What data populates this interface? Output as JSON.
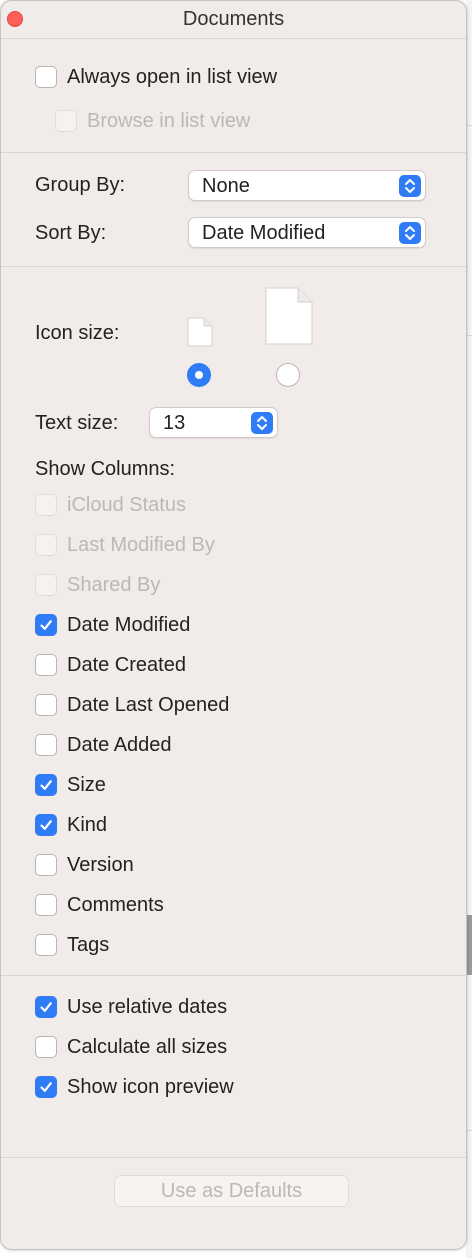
{
  "window": {
    "title": "Documents"
  },
  "top_options": [
    {
      "label": "Always open in list view",
      "checked": false,
      "disabled": false
    },
    {
      "label": "Browse in list view",
      "checked": false,
      "disabled": true
    }
  ],
  "group_by": {
    "label": "Group By:",
    "value": "None"
  },
  "sort_by": {
    "label": "Sort By:",
    "value": "Date Modified"
  },
  "icon_size": {
    "label": "Icon size:",
    "selected": "small"
  },
  "text_size": {
    "label": "Text size:",
    "value": "13"
  },
  "show_columns": {
    "label": "Show Columns:",
    "items": [
      {
        "label": "iCloud Status",
        "checked": false,
        "disabled": true
      },
      {
        "label": "Last Modified By",
        "checked": false,
        "disabled": true
      },
      {
        "label": "Shared By",
        "checked": false,
        "disabled": true
      },
      {
        "label": "Date Modified",
        "checked": true,
        "disabled": false
      },
      {
        "label": "Date Created",
        "checked": false,
        "disabled": false
      },
      {
        "label": "Date Last Opened",
        "checked": false,
        "disabled": false
      },
      {
        "label": "Date Added",
        "checked": false,
        "disabled": false
      },
      {
        "label": "Size",
        "checked": true,
        "disabled": false
      },
      {
        "label": "Kind",
        "checked": true,
        "disabled": false
      },
      {
        "label": "Version",
        "checked": false,
        "disabled": false
      },
      {
        "label": "Comments",
        "checked": false,
        "disabled": false
      },
      {
        "label": "Tags",
        "checked": false,
        "disabled": false
      }
    ]
  },
  "bottom_options": [
    {
      "label": "Use relative dates",
      "checked": true,
      "disabled": false
    },
    {
      "label": "Calculate all sizes",
      "checked": false,
      "disabled": false
    },
    {
      "label": "Show icon preview",
      "checked": true,
      "disabled": false
    }
  ],
  "defaults_button": {
    "label": "Use as Defaults",
    "disabled": true
  },
  "colors": {
    "accent": "#2f7cf6",
    "panel_bg": "#f1ece9",
    "close": "#fe5f57",
    "disabled_text": "#bdb8b5"
  }
}
